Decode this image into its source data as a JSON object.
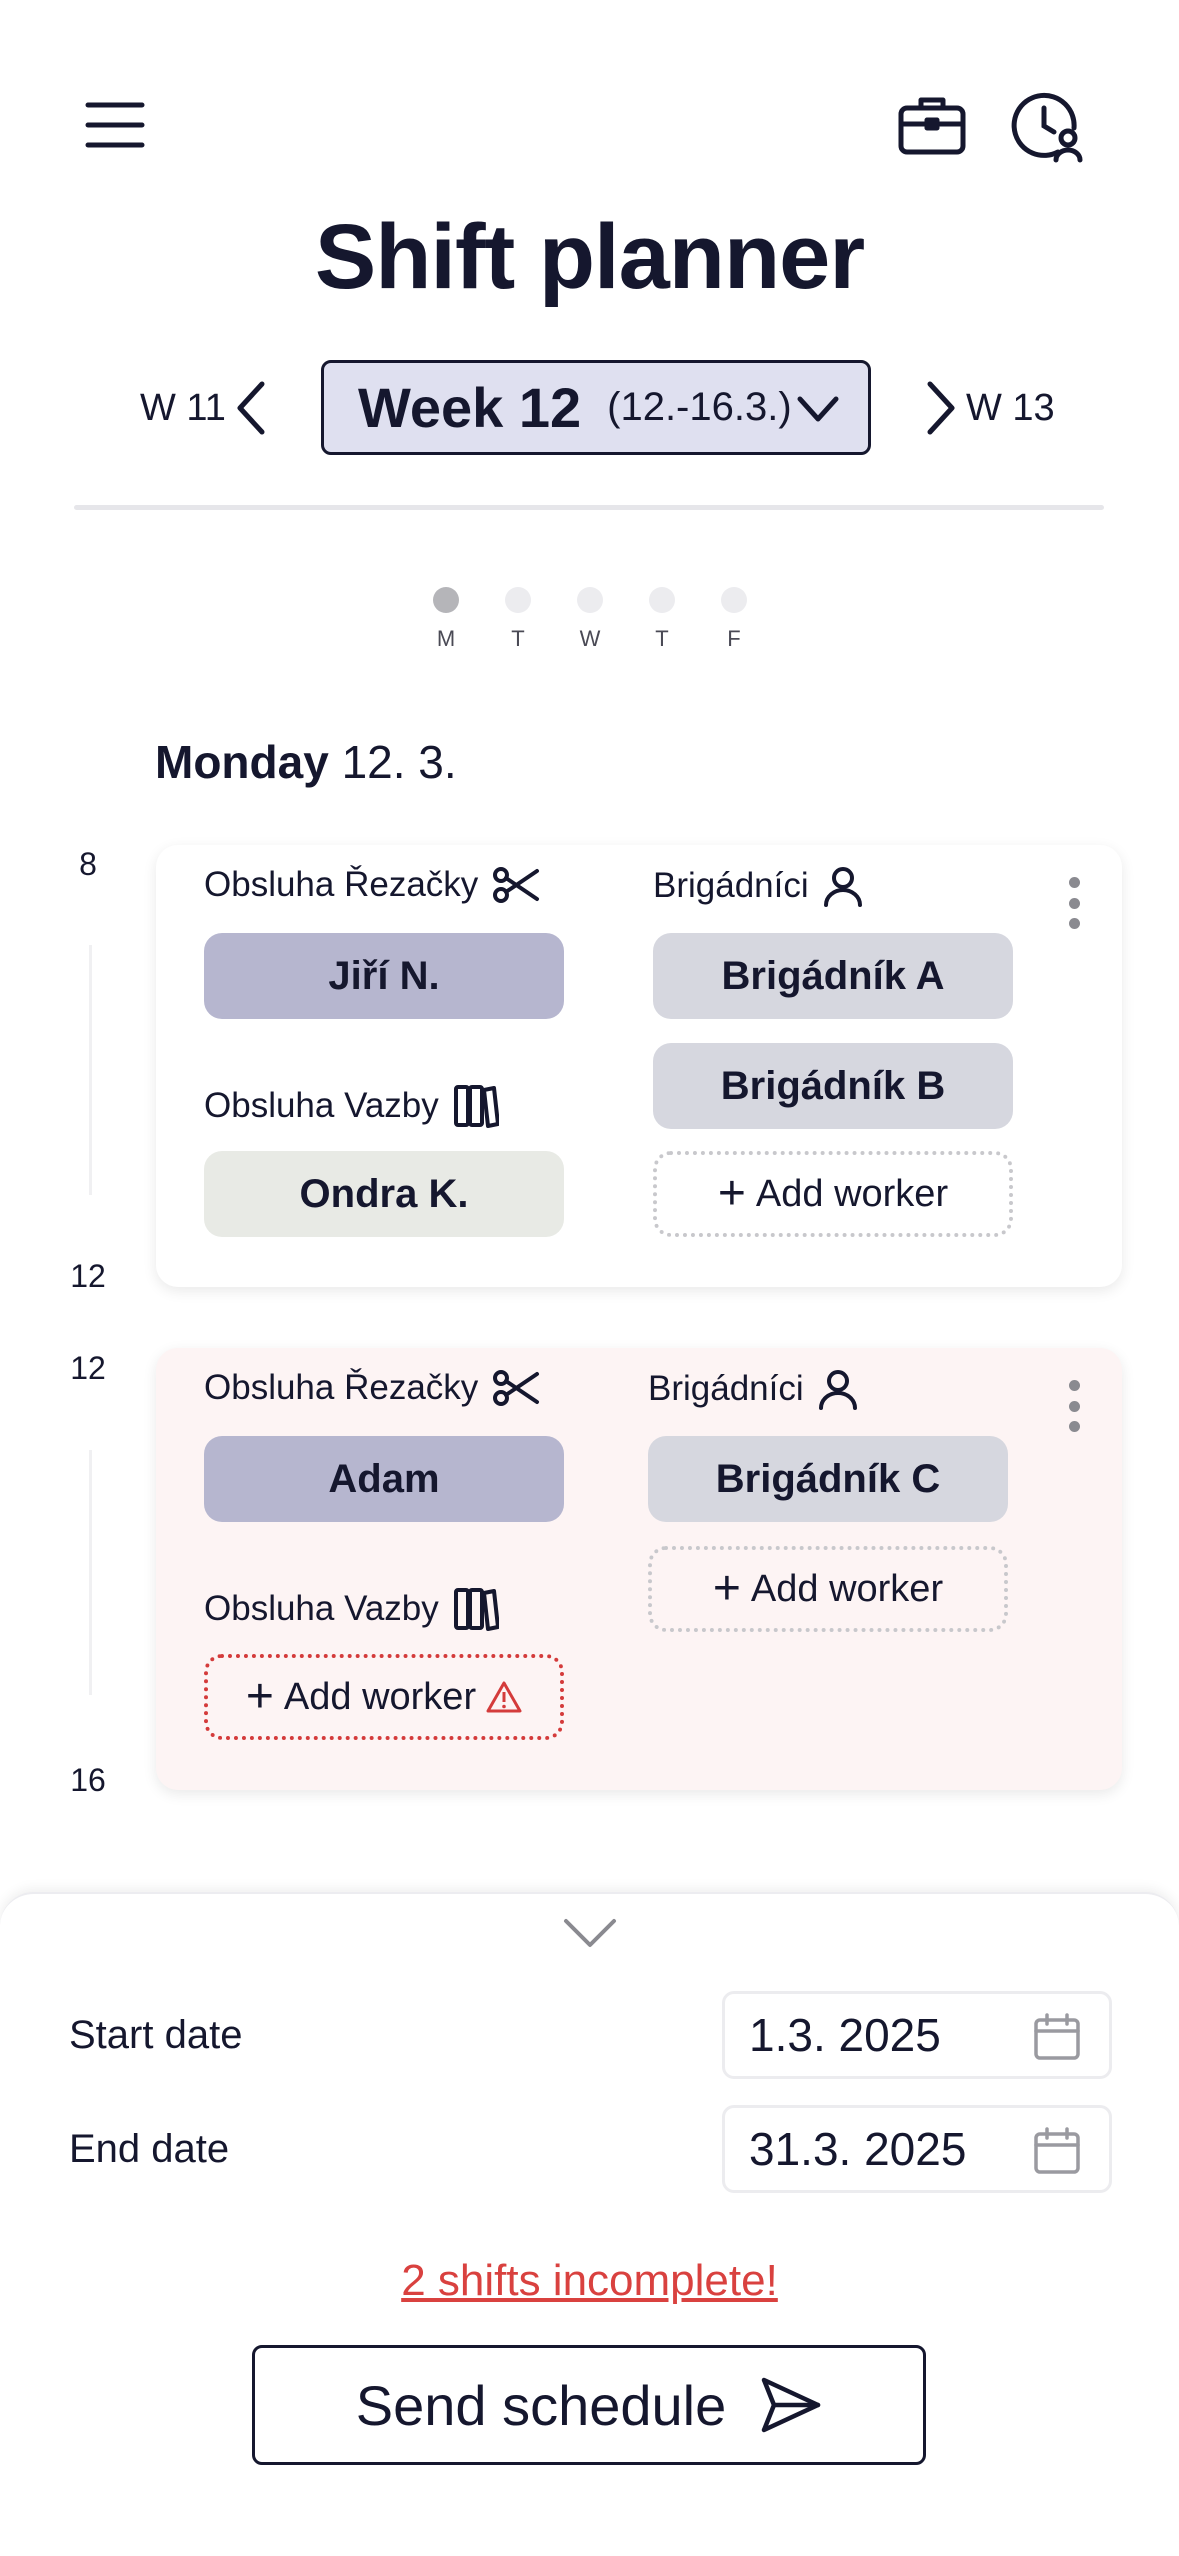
{
  "header": {
    "menu_icon": "hamburger-menu-icon",
    "briefcase_icon": "briefcase-icon",
    "history_icon": "clock-user-icon",
    "title": "Shift planner"
  },
  "week_nav": {
    "prev_label": "W 11",
    "next_label": "W 13",
    "current_week": "Week 12",
    "current_range": "(12.-16.3.)"
  },
  "days": [
    {
      "label": "M",
      "active": true
    },
    {
      "label": "T",
      "active": false
    },
    {
      "label": "W",
      "active": false
    },
    {
      "label": "T",
      "active": false
    },
    {
      "label": "F",
      "active": false
    }
  ],
  "day": {
    "weekday": "Monday",
    "date": "12. 3."
  },
  "shifts": [
    {
      "start": "8",
      "end": "12",
      "roles": [
        {
          "name": "Obsluha Řezačky",
          "icon": "scissors-icon",
          "workers": [
            "Jiří N."
          ]
        },
        {
          "name": "Obsluha Vazby",
          "icon": "books-icon",
          "workers": [
            "Ondra K."
          ]
        },
        {
          "name": "Brigádníci",
          "icon": "person-icon",
          "workers": [
            "Brigádník A",
            "Brigádník B"
          ],
          "add_label": "Add worker"
        }
      ]
    },
    {
      "start": "12",
      "end": "16",
      "roles": [
        {
          "name": "Obsluha Řezačky",
          "icon": "scissors-icon",
          "workers": [
            "Adam"
          ]
        },
        {
          "name": "Obsluha Vazby",
          "icon": "books-icon",
          "workers": [],
          "add_label": "Add worker"
        },
        {
          "name": "Brigádníci",
          "icon": "person-icon",
          "workers": [
            "Brigádník C"
          ],
          "add_label": "Add worker"
        }
      ]
    }
  ],
  "sheet": {
    "start_label": "Start date",
    "start_value": "1.3. 2025",
    "end_label": "End date",
    "end_value": "31.3. 2025",
    "warning": "2 shifts incomplete!",
    "send_label": "Send schedule"
  },
  "colors": {
    "primary": "#15172e",
    "week_select_bg": "#dfe0f0",
    "chip_purple": "#b6b6cf",
    "chip_grey": "#d6d7df",
    "chip_green": "#e8eae5",
    "incomplete_card_bg": "#fdf4f4",
    "warning": "#d9413f"
  }
}
